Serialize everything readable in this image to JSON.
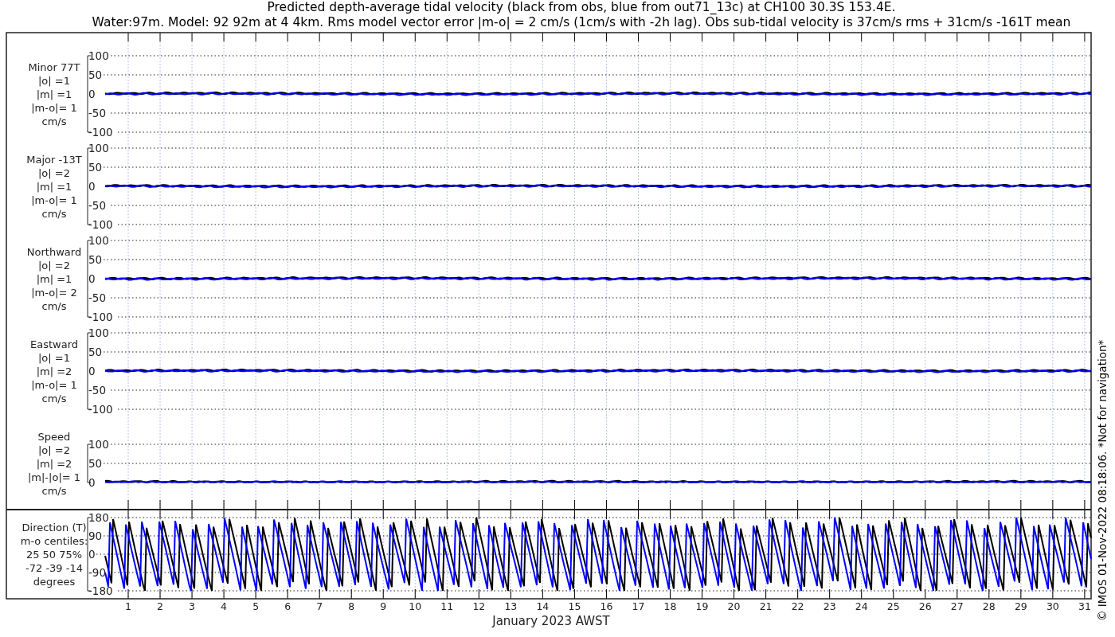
{
  "title_lines": [
    "Predicted depth-average tidal velocity (black from obs, blue from out71_13c) at CH100 30.3S 153.4E.",
    "Water:97m. Model: 92 92m at 4 4km. Rms model vector error |m-o| = 2 cm/s (1cm/s with -2h lag). Obs sub-tidal velocity is 37cm/s rms + 31cm/s -161T mean"
  ],
  "traces": [
    {
      "color": "#000000"
    },
    {
      "color": "#0000ff"
    }
  ],
  "panels": [
    {
      "kind": "velocity",
      "label_lines": [
        "Minor 77T",
        "|o| =1",
        "|m| =1",
        "|m-o|= 1",
        "cm/s"
      ],
      "yticks": [
        "100",
        "50",
        "0",
        "-50",
        "-100"
      ]
    },
    {
      "kind": "velocity",
      "label_lines": [
        "Major -13T",
        "|o| =2",
        "|m| =1",
        "|m-o|= 1",
        "cm/s"
      ],
      "yticks": [
        "100",
        "50",
        "0",
        "-50",
        "-100"
      ]
    },
    {
      "kind": "velocity",
      "label_lines": [
        "Northward",
        "|o| =2",
        "|m| =1",
        "|m-o|= 2",
        "cm/s"
      ],
      "yticks": [
        "100",
        "50",
        "0",
        "-50",
        "-100"
      ]
    },
    {
      "kind": "velocity",
      "label_lines": [
        "Eastward",
        "|o| =1",
        "|m| =2",
        "|m-o|= 1",
        "cm/s"
      ],
      "yticks": [
        "100",
        "50",
        "0",
        "-50",
        "-100"
      ]
    },
    {
      "kind": "velocity",
      "label_lines": [
        "Speed",
        "|o| =2",
        "|m| =2",
        "|m|-|o|= 1",
        "cm/s"
      ],
      "yticks": [
        "100",
        "50",
        "0"
      ]
    },
    {
      "kind": "direction",
      "label_lines": [
        "Direction (T)",
        "m-o centiles:",
        "25  50  75%",
        "-72 -39 -14",
        "degrees"
      ],
      "yticks": [
        "180",
        "90",
        "0",
        "-90",
        "-180"
      ]
    }
  ],
  "x_tick_labels": [
    "1",
    "2",
    "3",
    "4",
    "5",
    "6",
    "7",
    "8",
    "9",
    "10",
    "11",
    "12",
    "13",
    "14",
    "15",
    "16",
    "17",
    "18",
    "19",
    "20",
    "21",
    "22",
    "23",
    "24",
    "25",
    "26",
    "27",
    "28",
    "29",
    "30",
    "31"
  ],
  "xlabel": "January 2023 AWST",
  "credit": "© IMOS 01-Nov-2022 08:18:06. *Not for navigation*"
}
